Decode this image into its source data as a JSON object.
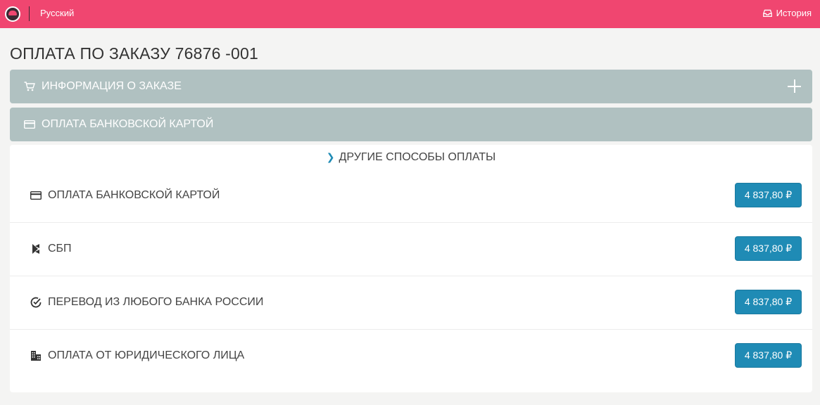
{
  "header": {
    "language": "Русский",
    "history_label": "История",
    "logo_icon": "restaurant-logo-icon",
    "history_icon": "inbox-icon",
    "accent_color": "#f04670"
  },
  "page": {
    "title": "ОПЛАТА ПО ЗАКАЗУ 76876 -001"
  },
  "sections": {
    "order_info": {
      "label": "ИНФОРМАЦИЯ О ЗАКАЗЕ",
      "icon": "cart-icon",
      "expand_icon": "plus-icon"
    },
    "card_payment": {
      "label": "ОПЛАТА БАНКОВСКОЙ КАРТОЙ",
      "icon": "credit-card-icon"
    }
  },
  "methods": {
    "other_label": "ДРУГИЕ СПОСОБЫ ОПЛАТЫ",
    "button_color": "#1f8bb5",
    "items": [
      {
        "label": "ОПЛАТА БАНКОВСКОЙ КАРТОЙ",
        "icon": "credit-card-icon",
        "amount": "4 837,80 ₽"
      },
      {
        "label": "СБП",
        "icon": "sbp-icon",
        "amount": "4 837,80 ₽"
      },
      {
        "label": "ПЕРЕВОД ИЗ ЛЮБОГО БАНКА РОССИИ",
        "icon": "check-circle-icon",
        "amount": "4 837,80 ₽"
      },
      {
        "label": "ОПЛАТА ОТ ЮРИДИЧЕСКОГО ЛИЦА",
        "icon": "building-icon",
        "amount": "4 837,80 ₽"
      }
    ]
  }
}
